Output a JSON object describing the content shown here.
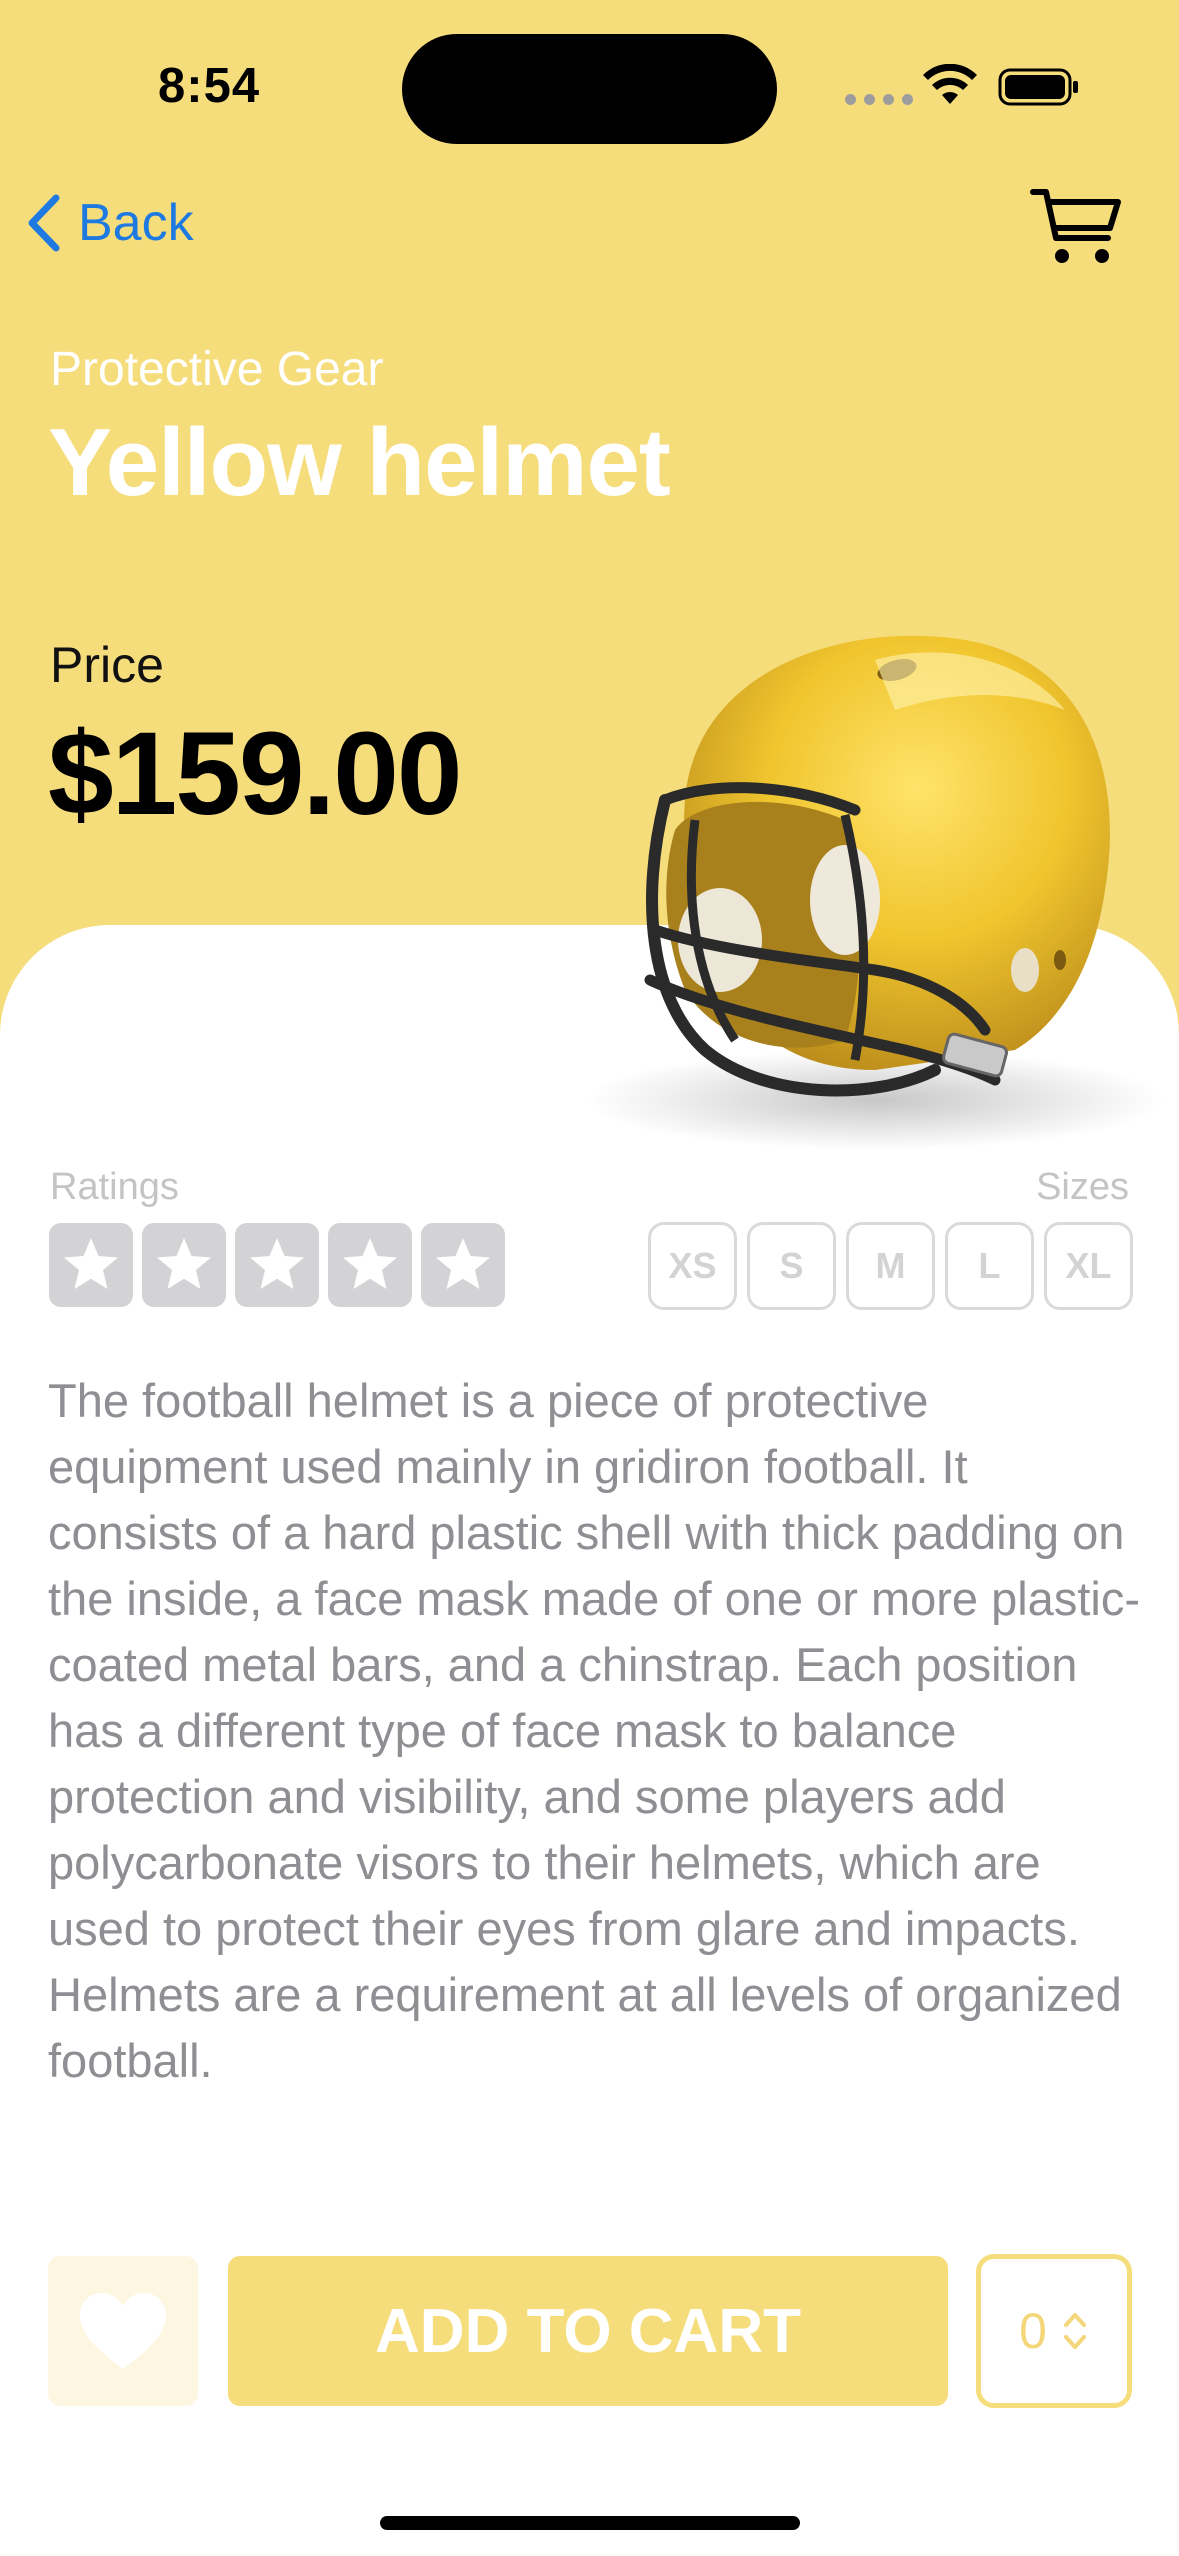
{
  "status_bar": {
    "time": "8:54"
  },
  "nav": {
    "back_label": "Back"
  },
  "product": {
    "category": "Protective Gear",
    "name": "Yellow helmet",
    "price_label": "Price",
    "price": "$159.00",
    "image_icon": "football-helmet-image",
    "ratings_label": "Ratings",
    "rating_value": 0,
    "rating_max": 5,
    "sizes_label": "Sizes",
    "sizes": [
      "XS",
      "S",
      "M",
      "L",
      "XL"
    ],
    "description": "The football helmet is a piece of protective equipment used mainly in gridiron football. It consists of a hard plastic shell with thick padding on the inside, a face mask made of one or more plastic-coated metal bars, and a chinstrap. Each position has a different type of face mask to balance protection and visibility, and some players add polycarbonate visors to their helmets, which are used to protect their eyes from glare and impacts. Helmets are a requirement at all levels of organized football."
  },
  "actions": {
    "add_to_cart_label": "ADD TO CART",
    "quantity": "0",
    "favorite_icon": "heart-icon"
  },
  "colors": {
    "accent_yellow": "#F6DD7C",
    "back_blue": "#1E7AE0",
    "description_gray": "#8e8e93",
    "inactive_gray": "#d3d3d6"
  }
}
